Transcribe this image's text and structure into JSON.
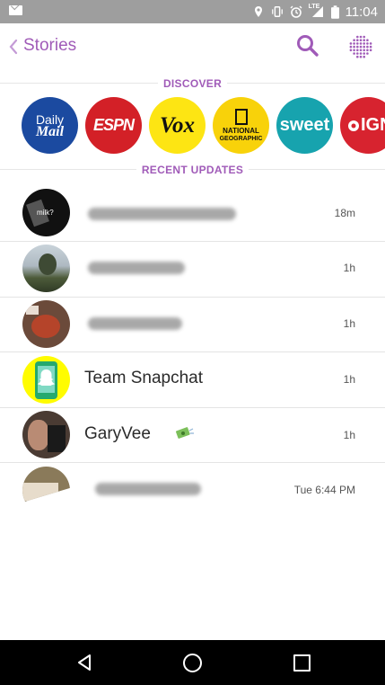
{
  "status_bar": {
    "time": "11:04",
    "network": "LTE"
  },
  "header": {
    "title": "Stories",
    "accent_color": "#a05bb8"
  },
  "discover": {
    "label": "DISCOVER",
    "channels": [
      {
        "line1": "Daily",
        "line2": "Mail",
        "bg": "#1b4aa0",
        "fg": "#ffffff"
      },
      {
        "line1": "ESPN",
        "bg": "#d32027",
        "fg": "#ffffff"
      },
      {
        "line1": "Vox",
        "bg": "#fde513",
        "fg": "#111111"
      },
      {
        "line1": "NATIONAL",
        "line2": "GEOGRAPHIC",
        "bg": "#f8d20a",
        "fg": "#111111"
      },
      {
        "line1": "sweet",
        "bg": "#17a3ae",
        "fg": "#ffffff"
      },
      {
        "line1": "IGN",
        "bg": "#d7232f",
        "fg": "#ffffff"
      }
    ]
  },
  "recent": {
    "label": "RECENT UPDATES",
    "stories": [
      {
        "name": "",
        "time": "18m"
      },
      {
        "name": "",
        "time": "1h"
      },
      {
        "name": "",
        "time": "1h"
      },
      {
        "name": "Team Snapchat",
        "time": "1h"
      },
      {
        "name": "GaryVee",
        "time": "1h"
      },
      {
        "name": "",
        "time": "Tue 6:44 PM"
      }
    ]
  },
  "avatar_overlay_text": "milk?"
}
